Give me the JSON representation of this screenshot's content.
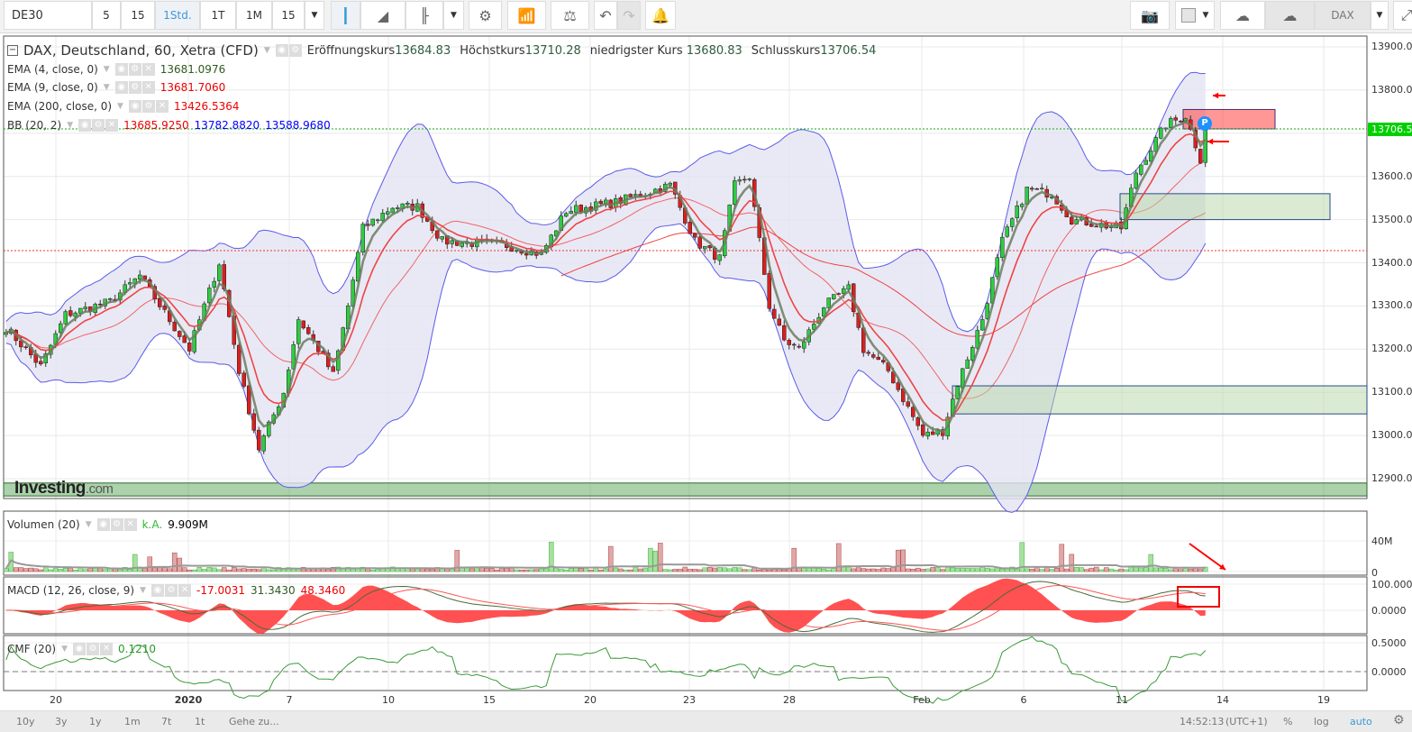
{
  "toolbar": {
    "symbol": "DE30",
    "intervals": [
      "5",
      "15",
      "1Std.",
      "1T",
      "1M",
      "15"
    ],
    "active_interval": "1Std.",
    "right_symbol": "DAX"
  },
  "legend": {
    "title": "DAX, Deutschland, 60, Xetra (CFD)",
    "open_label": "Eröffnungskurs",
    "open": "13684.83",
    "high_label": "Höchstkurs",
    "high": "13710.28",
    "low_label": "niedrigster Kurs",
    "low": "13680.83",
    "close_label": "Schlusskurs",
    "close": "13706.54",
    "ema4_label": "EMA (4, close, 0)",
    "ema4": "13681.0976",
    "ema9_label": "EMA (9, close, 0)",
    "ema9": "13681.7060",
    "ema200_label": "EMA (200, close, 0)",
    "ema200": "13426.5364",
    "bb_label": "BB (20, 2)",
    "bb_mid": "13685.9250",
    "bb_up": "13782.8820",
    "bb_low": "13588.9680"
  },
  "volume": {
    "label": "Volumen (20)",
    "na": "k.A.",
    "value": "9.909M",
    "ticks": [
      "40M",
      "0"
    ]
  },
  "macd": {
    "label": "MACD (12, 26, close, 9)",
    "v1": "-17.0031",
    "v2": "31.3430",
    "v3": "48.3460",
    "ticks": [
      "100.0000",
      "0.0000"
    ]
  },
  "cmf": {
    "label": "CMF (20)",
    "value": "0.1210",
    "ticks": [
      "0.5000",
      "0.0000"
    ]
  },
  "price_axis": [
    "13900.00",
    "13800.00",
    "13700.00",
    "13600.00",
    "13500.00",
    "13400.00",
    "13300.00",
    "13200.00",
    "13100.00",
    "13000.00",
    "12900.00"
  ],
  "current_price": "13706.54",
  "marker": "P",
  "logo": {
    "main": "Investing",
    "suffix": ".com"
  },
  "date_labels": [
    "20",
    "2020",
    "7",
    "10",
    "15",
    "20",
    "23",
    "28",
    "Feb",
    "6",
    "11",
    "14",
    "19"
  ],
  "bottom": {
    "ranges": [
      "10y",
      "3y",
      "1y",
      "1m",
      "7t",
      "1t"
    ],
    "goto": "Gehe zu...",
    "time": "14:52:13",
    "tz": "(UTC+1)",
    "pct": "%",
    "log": "log",
    "auto": "auto"
  },
  "colors": {
    "up": "#2ecc40",
    "down": "#d62020",
    "bb": "#5b5bea",
    "bb_fill": "#e3e3f3",
    "ema4": "#6b7d5e",
    "ema9": "#ee4444",
    "ema200": "#ee4444",
    "accent": "#3a9ad9"
  },
  "chart_data": {
    "type": "candlestick",
    "ylim": [
      12870,
      13930
    ],
    "bars": 243,
    "waypoints": [
      [
        0,
        13250
      ],
      [
        7,
        13160
      ],
      [
        12,
        13280
      ],
      [
        21,
        13310
      ],
      [
        27,
        13370
      ],
      [
        34,
        13250
      ],
      [
        37,
        13200
      ],
      [
        43,
        13400
      ],
      [
        47,
        13150
      ],
      [
        51,
        12970
      ],
      [
        56,
        13100
      ],
      [
        59,
        13270
      ],
      [
        63,
        13200
      ],
      [
        66,
        13140
      ],
      [
        69,
        13300
      ],
      [
        72,
        13480
      ],
      [
        78,
        13530
      ],
      [
        83,
        13530
      ],
      [
        88,
        13450
      ],
      [
        101,
        13440
      ],
      [
        108,
        13420
      ],
      [
        113,
        13520
      ],
      [
        123,
        13540
      ],
      [
        134,
        13580
      ],
      [
        139,
        13450
      ],
      [
        144,
        13410
      ],
      [
        147,
        13580
      ],
      [
        150,
        13600
      ],
      [
        154,
        13300
      ],
      [
        157,
        13220
      ],
      [
        160,
        13200
      ],
      [
        165,
        13300
      ],
      [
        170,
        13340
      ],
      [
        173,
        13200
      ],
      [
        178,
        13150
      ],
      [
        185,
        13000
      ],
      [
        189,
        13010
      ],
      [
        192,
        13120
      ],
      [
        197,
        13270
      ],
      [
        201,
        13450
      ],
      [
        206,
        13570
      ],
      [
        211,
        13560
      ],
      [
        215,
        13500
      ],
      [
        225,
        13480
      ],
      [
        228,
        13610
      ],
      [
        234,
        13720
      ],
      [
        238,
        13740
      ],
      [
        241,
        13640
      ],
      [
        243,
        13706
      ]
    ],
    "zones": [
      {
        "type": "resistance",
        "from": 13710,
        "to": 13755
      },
      {
        "type": "support",
        "from": 13500,
        "to": 13560
      },
      {
        "type": "support",
        "from": 13050,
        "to": 13115
      },
      {
        "type": "support",
        "from": 12860,
        "to": 12890
      }
    ]
  }
}
